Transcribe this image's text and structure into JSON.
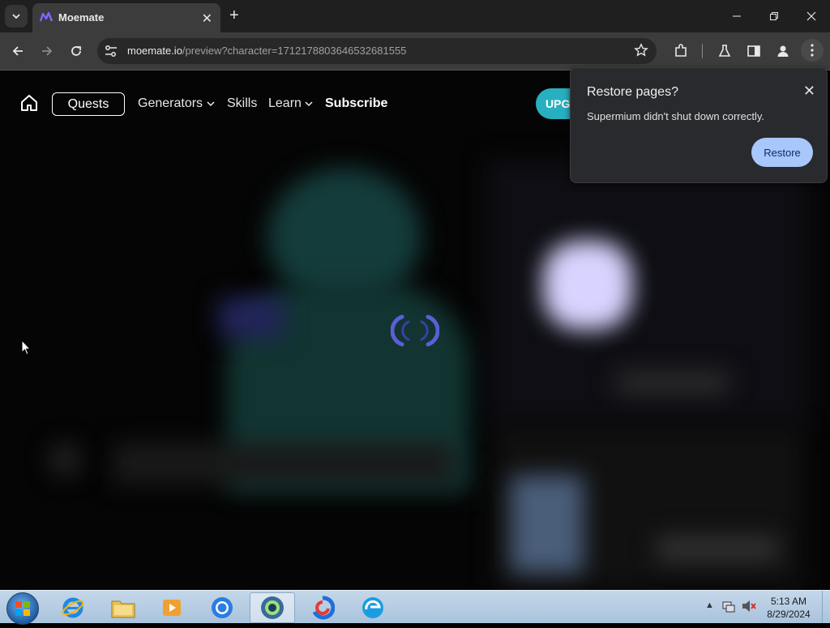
{
  "browser": {
    "tab_title": "Moemate",
    "tab_close": "✕",
    "new_tab": "+",
    "url_host": "moemate.io",
    "url_path": "/preview?character=1712178803646532681555"
  },
  "site_nav": {
    "quests": "Quests",
    "generators": "Generators",
    "skills": "Skills",
    "learn": "Learn",
    "subscribe": "Subscribe",
    "upgrade_partial": "UPG"
  },
  "restore_popup": {
    "title": "Restore pages?",
    "message": "Supermium didn't shut down correctly.",
    "restore_button": "Restore",
    "close": "✕"
  },
  "taskbar": {
    "time": "5:13 AM",
    "date": "8/29/2024"
  },
  "colors": {
    "accent_upgrade": "#28b0c0",
    "restore_button": "#a8c7fa",
    "spinner": "#5b5fd6"
  }
}
